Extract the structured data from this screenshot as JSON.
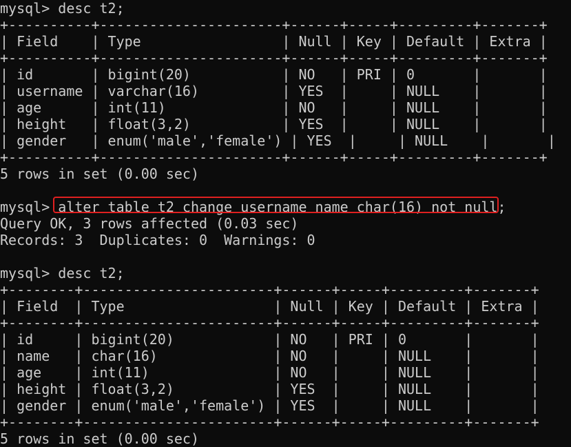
{
  "colors": {
    "background": "#0c0c0c",
    "text": "#cccccc",
    "highlight_border": "#e02020"
  },
  "terminal": {
    "lines": [
      "mysql> desc t2;",
      "+----------+----------------------+------+-----+---------+-------+",
      "| Field    | Type                 | Null | Key | Default | Extra |",
      "+----------+----------------------+------+-----+---------+-------+",
      "| id       | bigint(20)           | NO   | PRI | 0       |       |",
      "| username | varchar(16)          | YES  |     | NULL    |       |",
      "| age      | int(11)              | NO   |     | NULL    |       |",
      "| height   | float(3,2)           | YES  |     | NULL    |       |",
      "| gender   | enum('male','female') | YES  |     | NULL    |       |",
      "+----------+----------------------+------+-----+---------+-------+",
      "5 rows in set (0.00 sec)",
      "",
      "mysql> alter table t2 change username name char(16) not null;",
      "Query OK, 3 rows affected (0.03 sec)",
      "Records: 3  Duplicates: 0  Warnings: 0",
      "",
      "mysql> desc t2;",
      "+--------+-----------------------+------+-----+---------+-------+",
      "| Field  | Type                  | Null | Key | Default | Extra |",
      "+--------+-----------------------+------+-----+---------+-------+",
      "| id     | bigint(20)            | NO   | PRI | 0       |       |",
      "| name   | char(16)              | NO   |     | NULL    |       |",
      "| age    | int(11)               | NO   |     | NULL    |       |",
      "| height | float(3,2)            | YES  |     | NULL    |       |",
      "| gender | enum('male','female') | YES  |     | NULL    |       |",
      "+--------+-----------------------+------+-----+---------+-------+",
      "5 rows in set (0.00 sec)"
    ]
  }
}
